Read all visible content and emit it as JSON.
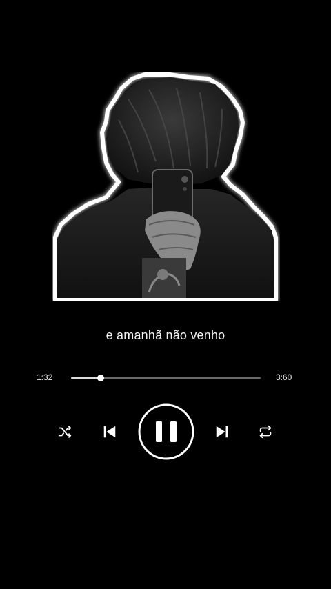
{
  "player": {
    "lyric": "e amanhã não venho",
    "elapsed": "1:32",
    "total": "3:60",
    "progress": 0.155,
    "state": "playing"
  },
  "controls": {
    "shuffle_icon": "shuffle-icon",
    "previous_icon": "skip-previous-icon",
    "play_pause_icon": "pause-icon",
    "next_icon": "skip-next-icon",
    "repeat_icon": "repeat-icon"
  },
  "colors": {
    "background": "#000000",
    "foreground": "#ffffff",
    "track": "#6a6a6a"
  }
}
